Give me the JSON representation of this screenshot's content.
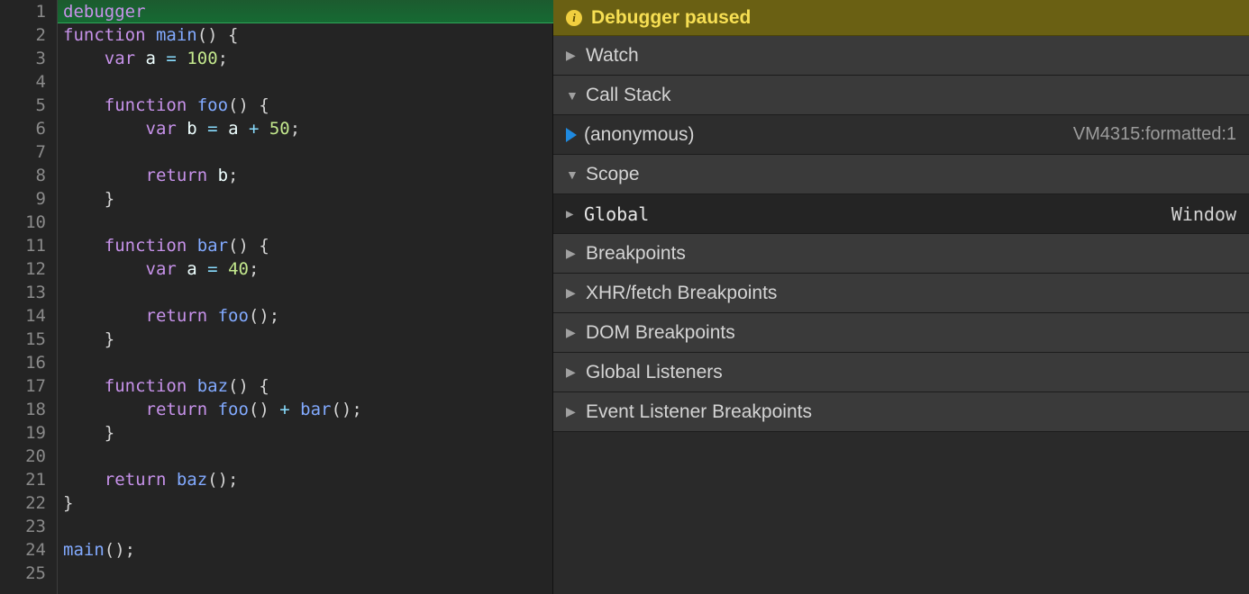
{
  "editor": {
    "line_count": 25,
    "highlighted_line": 1,
    "lines": [
      {
        "n": 1,
        "tokens": [
          {
            "t": "debugger",
            "c": "kw"
          }
        ]
      },
      {
        "n": 2,
        "tokens": [
          {
            "t": "function ",
            "c": "kw"
          },
          {
            "t": "main",
            "c": "fn"
          },
          {
            "t": "() {",
            "c": "pn"
          }
        ]
      },
      {
        "n": 3,
        "tokens": [
          {
            "t": "    ",
            "c": "pn"
          },
          {
            "t": "var ",
            "c": "kw"
          },
          {
            "t": "a ",
            "c": "va"
          },
          {
            "t": "= ",
            "c": "op"
          },
          {
            "t": "100",
            "c": "nm2"
          },
          {
            "t": ";",
            "c": "pn"
          }
        ]
      },
      {
        "n": 4,
        "tokens": []
      },
      {
        "n": 5,
        "tokens": [
          {
            "t": "    ",
            "c": "pn"
          },
          {
            "t": "function ",
            "c": "kw"
          },
          {
            "t": "foo",
            "c": "fn"
          },
          {
            "t": "() {",
            "c": "pn"
          }
        ]
      },
      {
        "n": 6,
        "tokens": [
          {
            "t": "        ",
            "c": "pn"
          },
          {
            "t": "var ",
            "c": "kw"
          },
          {
            "t": "b ",
            "c": "va"
          },
          {
            "t": "= ",
            "c": "op"
          },
          {
            "t": "a ",
            "c": "va"
          },
          {
            "t": "+ ",
            "c": "op"
          },
          {
            "t": "50",
            "c": "nm2"
          },
          {
            "t": ";",
            "c": "pn"
          }
        ]
      },
      {
        "n": 7,
        "tokens": []
      },
      {
        "n": 8,
        "tokens": [
          {
            "t": "        ",
            "c": "pn"
          },
          {
            "t": "return ",
            "c": "kw"
          },
          {
            "t": "b",
            "c": "va"
          },
          {
            "t": ";",
            "c": "pn"
          }
        ]
      },
      {
        "n": 9,
        "tokens": [
          {
            "t": "    }",
            "c": "pn"
          }
        ]
      },
      {
        "n": 10,
        "tokens": []
      },
      {
        "n": 11,
        "tokens": [
          {
            "t": "    ",
            "c": "pn"
          },
          {
            "t": "function ",
            "c": "kw"
          },
          {
            "t": "bar",
            "c": "fn"
          },
          {
            "t": "() {",
            "c": "pn"
          }
        ]
      },
      {
        "n": 12,
        "tokens": [
          {
            "t": "        ",
            "c": "pn"
          },
          {
            "t": "var ",
            "c": "kw"
          },
          {
            "t": "a ",
            "c": "va"
          },
          {
            "t": "= ",
            "c": "op"
          },
          {
            "t": "40",
            "c": "nm2"
          },
          {
            "t": ";",
            "c": "pn"
          }
        ]
      },
      {
        "n": 13,
        "tokens": []
      },
      {
        "n": 14,
        "tokens": [
          {
            "t": "        ",
            "c": "pn"
          },
          {
            "t": "return ",
            "c": "kw"
          },
          {
            "t": "foo",
            "c": "fn"
          },
          {
            "t": "();",
            "c": "pn"
          }
        ]
      },
      {
        "n": 15,
        "tokens": [
          {
            "t": "    }",
            "c": "pn"
          }
        ]
      },
      {
        "n": 16,
        "tokens": []
      },
      {
        "n": 17,
        "tokens": [
          {
            "t": "    ",
            "c": "pn"
          },
          {
            "t": "function ",
            "c": "kw"
          },
          {
            "t": "baz",
            "c": "fn"
          },
          {
            "t": "() {",
            "c": "pn"
          }
        ]
      },
      {
        "n": 18,
        "tokens": [
          {
            "t": "        ",
            "c": "pn"
          },
          {
            "t": "return ",
            "c": "kw"
          },
          {
            "t": "foo",
            "c": "fn"
          },
          {
            "t": "() ",
            "c": "pn"
          },
          {
            "t": "+ ",
            "c": "op"
          },
          {
            "t": "bar",
            "c": "fn"
          },
          {
            "t": "();",
            "c": "pn"
          }
        ]
      },
      {
        "n": 19,
        "tokens": [
          {
            "t": "    }",
            "c": "pn"
          }
        ]
      },
      {
        "n": 20,
        "tokens": []
      },
      {
        "n": 21,
        "tokens": [
          {
            "t": "    ",
            "c": "pn"
          },
          {
            "t": "return ",
            "c": "kw"
          },
          {
            "t": "baz",
            "c": "fn"
          },
          {
            "t": "();",
            "c": "pn"
          }
        ]
      },
      {
        "n": 22,
        "tokens": [
          {
            "t": "}",
            "c": "pn"
          }
        ]
      },
      {
        "n": 23,
        "tokens": []
      },
      {
        "n": 24,
        "tokens": [
          {
            "t": "main",
            "c": "fn"
          },
          {
            "t": "();",
            "c": "pn"
          }
        ]
      },
      {
        "n": 25,
        "tokens": []
      }
    ]
  },
  "debugger": {
    "paused_label": "Debugger paused",
    "sections": {
      "watch": {
        "label": "Watch",
        "expanded": false
      },
      "call_stack": {
        "label": "Call Stack",
        "expanded": true,
        "frames": [
          {
            "name": "(anonymous)",
            "location": "VM4315:formatted:1",
            "current": true
          }
        ]
      },
      "scope": {
        "label": "Scope",
        "expanded": true,
        "entries": [
          {
            "name": "Global",
            "value": "Window",
            "expanded": false
          }
        ]
      },
      "breakpoints": {
        "label": "Breakpoints",
        "expanded": false
      },
      "xhr": {
        "label": "XHR/fetch Breakpoints",
        "expanded": false
      },
      "dom": {
        "label": "DOM Breakpoints",
        "expanded": false
      },
      "global_listeners": {
        "label": "Global Listeners",
        "expanded": false
      },
      "event_listener": {
        "label": "Event Listener Breakpoints",
        "expanded": false
      }
    }
  },
  "icons": {
    "tri_right": "▶",
    "tri_down": "▼",
    "info": "i"
  }
}
